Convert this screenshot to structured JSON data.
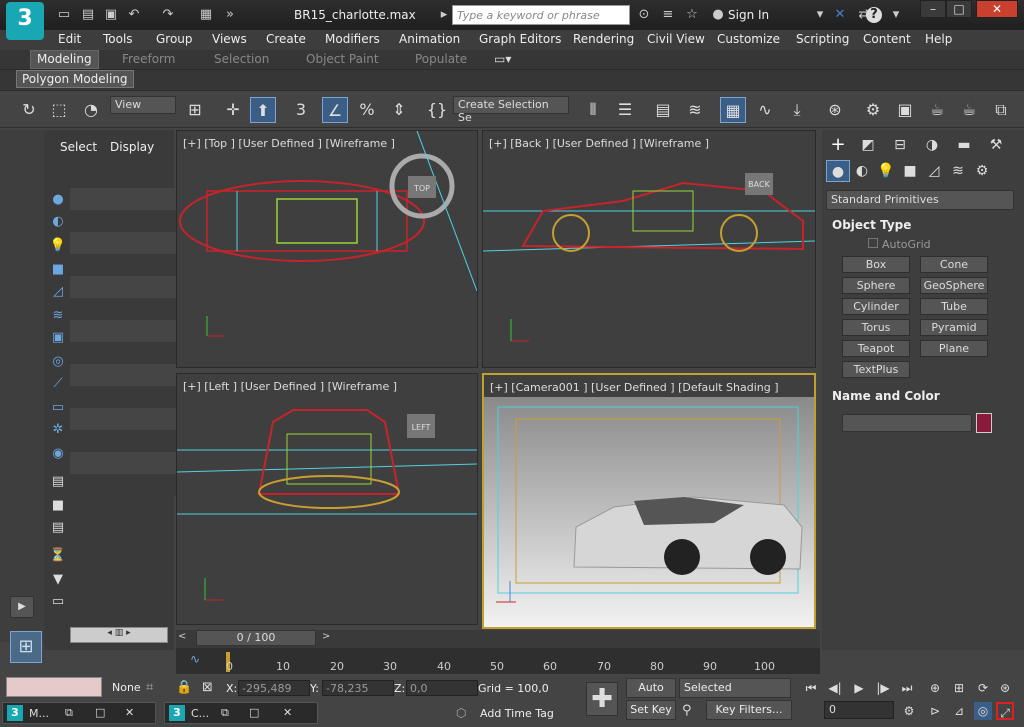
{
  "app": {
    "logo": "3",
    "doc_title": "BR15_charlotte.max"
  },
  "titlebar": {
    "search_placeholder": "Type a keyword or phrase",
    "signin": "Sign In",
    "help": "?",
    "win_min": "–",
    "win_max": "□",
    "win_close": "✕"
  },
  "menu": [
    "Edit",
    "Tools",
    "Group",
    "Views",
    "Create",
    "Modifiers",
    "Animation",
    "Graph Editors",
    "Rendering",
    "Civil View",
    "Customize",
    "Scripting",
    "Content",
    "Help"
  ],
  "ribbon": {
    "tabs": [
      "Modeling",
      "Freeform",
      "Selection",
      "Object Paint",
      "Populate"
    ],
    "active_panel": "Polygon Modeling"
  },
  "toolbar": {
    "view_dd": "View",
    "selection_set": "Create Selection Se"
  },
  "scene_explorer": {
    "tabs": [
      "Select",
      "Display"
    ]
  },
  "viewports": {
    "top": {
      "label": "[+] [Top ] [User Defined ] [Wireframe ]",
      "cube": "TOP"
    },
    "back": {
      "label": "[+] [Back ] [User Defined ] [Wireframe ]",
      "cube": "BACK"
    },
    "left": {
      "label": "[+] [Left ] [User Defined ] [Wireframe ]",
      "cube": "LEFT"
    },
    "camera": {
      "label": "[+] [Camera001 ] [User Defined ] [Default Shading ]"
    }
  },
  "command_panel": {
    "category": "Standard Primitives",
    "object_type_title": "Object Type",
    "autogrid": "AutoGrid",
    "primitives": [
      "Box",
      "Cone",
      "Sphere",
      "GeoSphere",
      "Cylinder",
      "Tube",
      "Torus",
      "Pyramid",
      "Teapot",
      "Plane",
      "TextPlus"
    ],
    "name_color_title": "Name and Color"
  },
  "timeline": {
    "frame_range": "0 / 100",
    "ticks": [
      "0",
      "10",
      "20",
      "30",
      "40",
      "50",
      "60",
      "70",
      "80",
      "90",
      "100"
    ]
  },
  "status": {
    "selection": "None",
    "x_label": "X:",
    "x_value": "-295,489",
    "y_label": "Y:",
    "y_value": "-78,235",
    "z_label": "Z:",
    "z_value": "0,0",
    "grid": "Grid = 100,0",
    "add_time_tag": "Add Time Tag",
    "auto_key": "Auto Key",
    "set_key": "Set Key",
    "selected_dd": "Selected",
    "key_filters": "Key Filters...",
    "frame": "0"
  },
  "taskbar": [
    {
      "label": "M..."
    },
    {
      "label": "C..."
    }
  ]
}
